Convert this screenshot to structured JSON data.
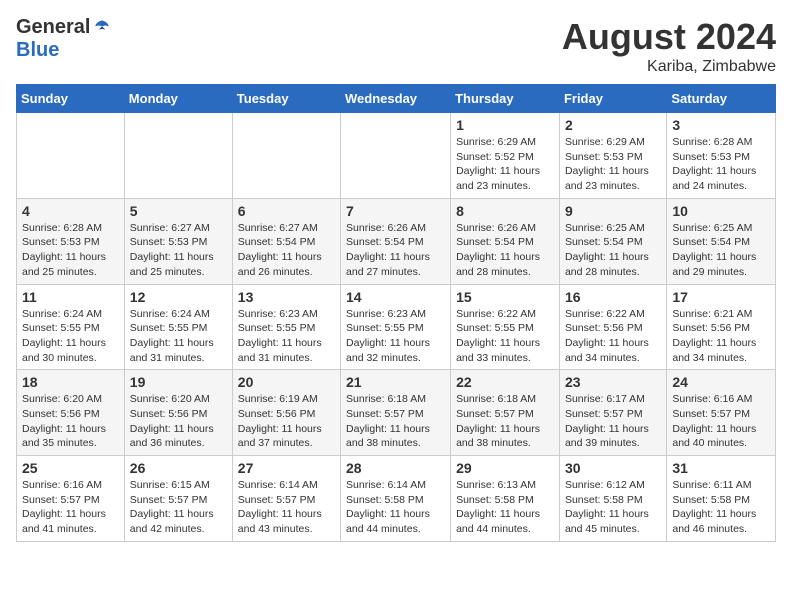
{
  "header": {
    "logo_general": "General",
    "logo_blue": "Blue",
    "month": "August 2024",
    "location": "Kariba, Zimbabwe"
  },
  "days_of_week": [
    "Sunday",
    "Monday",
    "Tuesday",
    "Wednesday",
    "Thursday",
    "Friday",
    "Saturday"
  ],
  "weeks": [
    [
      {
        "day": "",
        "info": ""
      },
      {
        "day": "",
        "info": ""
      },
      {
        "day": "",
        "info": ""
      },
      {
        "day": "",
        "info": ""
      },
      {
        "day": "1",
        "info": "Sunrise: 6:29 AM\nSunset: 5:52 PM\nDaylight: 11 hours and 23 minutes."
      },
      {
        "day": "2",
        "info": "Sunrise: 6:29 AM\nSunset: 5:53 PM\nDaylight: 11 hours and 23 minutes."
      },
      {
        "day": "3",
        "info": "Sunrise: 6:28 AM\nSunset: 5:53 PM\nDaylight: 11 hours and 24 minutes."
      }
    ],
    [
      {
        "day": "4",
        "info": "Sunrise: 6:28 AM\nSunset: 5:53 PM\nDaylight: 11 hours and 25 minutes."
      },
      {
        "day": "5",
        "info": "Sunrise: 6:27 AM\nSunset: 5:53 PM\nDaylight: 11 hours and 25 minutes."
      },
      {
        "day": "6",
        "info": "Sunrise: 6:27 AM\nSunset: 5:54 PM\nDaylight: 11 hours and 26 minutes."
      },
      {
        "day": "7",
        "info": "Sunrise: 6:26 AM\nSunset: 5:54 PM\nDaylight: 11 hours and 27 minutes."
      },
      {
        "day": "8",
        "info": "Sunrise: 6:26 AM\nSunset: 5:54 PM\nDaylight: 11 hours and 28 minutes."
      },
      {
        "day": "9",
        "info": "Sunrise: 6:25 AM\nSunset: 5:54 PM\nDaylight: 11 hours and 28 minutes."
      },
      {
        "day": "10",
        "info": "Sunrise: 6:25 AM\nSunset: 5:54 PM\nDaylight: 11 hours and 29 minutes."
      }
    ],
    [
      {
        "day": "11",
        "info": "Sunrise: 6:24 AM\nSunset: 5:55 PM\nDaylight: 11 hours and 30 minutes."
      },
      {
        "day": "12",
        "info": "Sunrise: 6:24 AM\nSunset: 5:55 PM\nDaylight: 11 hours and 31 minutes."
      },
      {
        "day": "13",
        "info": "Sunrise: 6:23 AM\nSunset: 5:55 PM\nDaylight: 11 hours and 31 minutes."
      },
      {
        "day": "14",
        "info": "Sunrise: 6:23 AM\nSunset: 5:55 PM\nDaylight: 11 hours and 32 minutes."
      },
      {
        "day": "15",
        "info": "Sunrise: 6:22 AM\nSunset: 5:55 PM\nDaylight: 11 hours and 33 minutes."
      },
      {
        "day": "16",
        "info": "Sunrise: 6:22 AM\nSunset: 5:56 PM\nDaylight: 11 hours and 34 minutes."
      },
      {
        "day": "17",
        "info": "Sunrise: 6:21 AM\nSunset: 5:56 PM\nDaylight: 11 hours and 34 minutes."
      }
    ],
    [
      {
        "day": "18",
        "info": "Sunrise: 6:20 AM\nSunset: 5:56 PM\nDaylight: 11 hours and 35 minutes."
      },
      {
        "day": "19",
        "info": "Sunrise: 6:20 AM\nSunset: 5:56 PM\nDaylight: 11 hours and 36 minutes."
      },
      {
        "day": "20",
        "info": "Sunrise: 6:19 AM\nSunset: 5:56 PM\nDaylight: 11 hours and 37 minutes."
      },
      {
        "day": "21",
        "info": "Sunrise: 6:18 AM\nSunset: 5:57 PM\nDaylight: 11 hours and 38 minutes."
      },
      {
        "day": "22",
        "info": "Sunrise: 6:18 AM\nSunset: 5:57 PM\nDaylight: 11 hours and 38 minutes."
      },
      {
        "day": "23",
        "info": "Sunrise: 6:17 AM\nSunset: 5:57 PM\nDaylight: 11 hours and 39 minutes."
      },
      {
        "day": "24",
        "info": "Sunrise: 6:16 AM\nSunset: 5:57 PM\nDaylight: 11 hours and 40 minutes."
      }
    ],
    [
      {
        "day": "25",
        "info": "Sunrise: 6:16 AM\nSunset: 5:57 PM\nDaylight: 11 hours and 41 minutes."
      },
      {
        "day": "26",
        "info": "Sunrise: 6:15 AM\nSunset: 5:57 PM\nDaylight: 11 hours and 42 minutes."
      },
      {
        "day": "27",
        "info": "Sunrise: 6:14 AM\nSunset: 5:57 PM\nDaylight: 11 hours and 43 minutes."
      },
      {
        "day": "28",
        "info": "Sunrise: 6:14 AM\nSunset: 5:58 PM\nDaylight: 11 hours and 44 minutes."
      },
      {
        "day": "29",
        "info": "Sunrise: 6:13 AM\nSunset: 5:58 PM\nDaylight: 11 hours and 44 minutes."
      },
      {
        "day": "30",
        "info": "Sunrise: 6:12 AM\nSunset: 5:58 PM\nDaylight: 11 hours and 45 minutes."
      },
      {
        "day": "31",
        "info": "Sunrise: 6:11 AM\nSunset: 5:58 PM\nDaylight: 11 hours and 46 minutes."
      }
    ]
  ]
}
